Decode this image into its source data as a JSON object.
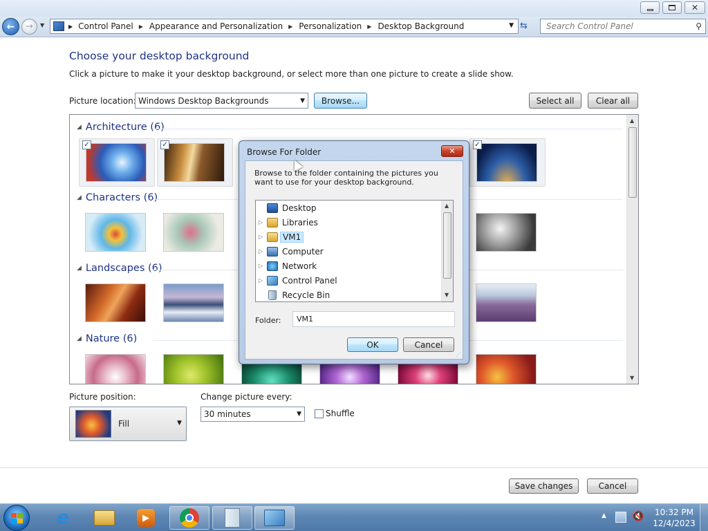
{
  "window": {
    "title": ""
  },
  "address": {
    "crumbs": [
      "Control Panel",
      "Appearance and Personalization",
      "Personalization",
      "Desktop Background"
    ]
  },
  "search": {
    "placeholder": "Search Control Panel"
  },
  "main": {
    "heading": "Choose your desktop background",
    "subheading": "Click a picture to make it your desktop background, or select more than one picture to create a slide show.",
    "picture_location_label": "Picture location:",
    "picture_location_value": "Windows Desktop Backgrounds",
    "browse_label": "Browse...",
    "select_all_label": "Select all",
    "clear_all_label": "Clear all"
  },
  "categories": [
    {
      "name": "Architecture (6)"
    },
    {
      "name": "Characters (6)"
    },
    {
      "name": "Landscapes (6)"
    },
    {
      "name": "Nature (6)"
    }
  ],
  "position": {
    "label": "Picture position:",
    "value": "Fill"
  },
  "interval": {
    "label": "Change picture every:",
    "value": "30 minutes"
  },
  "shuffle": {
    "label": "Shuffle",
    "checked": false
  },
  "footer": {
    "save_label": "Save changes",
    "cancel_label": "Cancel"
  },
  "dialog": {
    "title": "Browse For Folder",
    "instruction": "Browse to the folder containing the pictures you want to use for your desktop background.",
    "tree": [
      {
        "label": "Desktop",
        "icon": "desktop-icon",
        "expandable": false
      },
      {
        "label": "Libraries",
        "icon": "libraries-icon",
        "expandable": true
      },
      {
        "label": "VM1",
        "icon": "user-folder-icon",
        "expandable": true,
        "selected": true
      },
      {
        "label": "Computer",
        "icon": "computer-icon",
        "expandable": true
      },
      {
        "label": "Network",
        "icon": "network-icon",
        "expandable": true
      },
      {
        "label": "Control Panel",
        "icon": "control-panel-icon",
        "expandable": true
      },
      {
        "label": "Recycle Bin",
        "icon": "recycle-bin-icon",
        "expandable": false
      }
    ],
    "folder_label": "Folder:",
    "folder_value": "VM1",
    "ok_label": "OK",
    "cancel_label": "Cancel"
  },
  "taskbar": {
    "time": "10:32 PM",
    "date": "12/4/2023",
    "apps": [
      "internet-explorer-icon",
      "windows-explorer-icon",
      "media-player-icon",
      "chrome-icon",
      "notepad-icon",
      "control-panel-icon"
    ]
  },
  "colors": {
    "accent": "#1e3287",
    "selection": "#cce8ff",
    "taskbar": "#5d86b3"
  }
}
